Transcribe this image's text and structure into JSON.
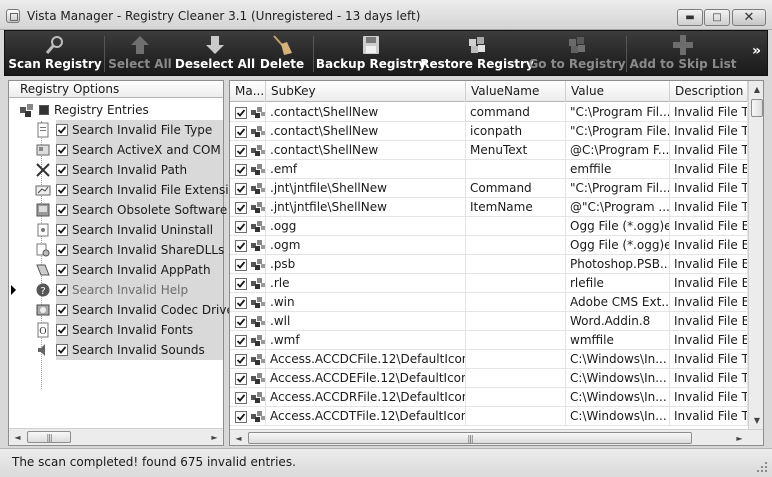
{
  "window": {
    "title": "Vista Manager - Registry Cleaner 3.1 (Unregistered - 13 days left)",
    "minimize_glyph": "▬",
    "maximize_glyph": "□",
    "close_glyph": "✕"
  },
  "toolbar": {
    "buttons": [
      {
        "label": "Scan Registry",
        "icon": "magnifier-icon",
        "enabled": true
      },
      {
        "label": "Select All",
        "icon": "arrow-up-icon",
        "enabled": false
      },
      {
        "label": "Deselect All",
        "icon": "arrow-down-icon",
        "enabled": true
      },
      {
        "label": "Delete",
        "icon": "broom-icon",
        "enabled": true
      },
      {
        "label": "Backup Registry",
        "icon": "floppy-disk-icon",
        "enabled": true
      },
      {
        "label": "Restore Registry",
        "icon": "restore-registry-icon",
        "enabled": true
      },
      {
        "label": "Go to Registry",
        "icon": "go-to-registry-icon",
        "enabled": false
      },
      {
        "label": "Add to Skip List",
        "icon": "plus-icon",
        "enabled": false
      }
    ],
    "more_glyph": "»"
  },
  "left_panel": {
    "header": "Registry Options",
    "root_label": "Registry Entries",
    "items": [
      {
        "label": "Search Invalid File Type",
        "icon": "file-type-icon",
        "checked": true
      },
      {
        "label": "Search ActiveX and COM",
        "icon": "activex-icon",
        "checked": true
      },
      {
        "label": "Search Invalid Path",
        "icon": "invalid-path-icon",
        "checked": true
      },
      {
        "label": "Search Invalid File Extension",
        "icon": "file-extension-icon",
        "checked": true
      },
      {
        "label": "Search Obsolete Software",
        "icon": "obsolete-software-icon",
        "checked": true
      },
      {
        "label": "Search Invalid Uninstall",
        "icon": "uninstall-icon",
        "checked": true
      },
      {
        "label": "Search Invalid ShareDLLs",
        "icon": "sharedlls-icon",
        "checked": true
      },
      {
        "label": "Search Invalid AppPath",
        "icon": "apppath-icon",
        "checked": true
      },
      {
        "label": "Search Invalid Help",
        "icon": "help-icon",
        "checked": true,
        "greyed": true,
        "current": true
      },
      {
        "label": "Search Invalid Codec Driver",
        "icon": "codec-driver-icon",
        "checked": true
      },
      {
        "label": "Search Invalid Fonts",
        "icon": "fonts-icon",
        "checked": true
      },
      {
        "label": "Search Invalid Sounds",
        "icon": "sounds-icon",
        "checked": true
      }
    ]
  },
  "grid": {
    "columns": [
      "Ma...",
      "SubKey",
      "ValueName",
      "Value",
      "Description"
    ],
    "rows": [
      {
        "subkey": ".contact\\ShellNew",
        "valuename": "command",
        "value": "\"C:\\Program Fil...",
        "description": "Invalid File Ty"
      },
      {
        "subkey": ".contact\\ShellNew",
        "valuename": "iconpath",
        "value": "\"C:\\Program File...",
        "description": "Invalid File Ty"
      },
      {
        "subkey": ".contact\\ShellNew",
        "valuename": "MenuText",
        "value": "@C:\\Program F...",
        "description": "Invalid File Ty"
      },
      {
        "subkey": ".emf",
        "valuename": "",
        "value": "emffile",
        "description": "Invalid File Ex"
      },
      {
        "subkey": ".jnt\\jntfile\\ShellNew",
        "valuename": "Command",
        "value": "\"C:\\Program Fil...",
        "description": "Invalid File Ty"
      },
      {
        "subkey": ".jnt\\jntfile\\ShellNew",
        "valuename": "ItemName",
        "value": "@\"C:\\Program ...",
        "description": "Invalid File Ty"
      },
      {
        "subkey": ".ogg",
        "valuename": "",
        "value": "Ogg File (*.ogg)e",
        "description": "Invalid File Ex"
      },
      {
        "subkey": ".ogm",
        "valuename": "",
        "value": "Ogg File (*.ogg)e",
        "description": "Invalid File Ex"
      },
      {
        "subkey": ".psb",
        "valuename": "",
        "value": "Photoshop.PSB....",
        "description": "Invalid File Ex"
      },
      {
        "subkey": ".rle",
        "valuename": "",
        "value": "rlefile",
        "description": "Invalid File Ex"
      },
      {
        "subkey": ".win",
        "valuename": "",
        "value": "Adobe CMS Ext...",
        "description": "Invalid File Ex"
      },
      {
        "subkey": ".wll",
        "valuename": "",
        "value": "Word.Addin.8",
        "description": "Invalid File Ex"
      },
      {
        "subkey": ".wmf",
        "valuename": "",
        "value": "wmffile",
        "description": "Invalid File Ex"
      },
      {
        "subkey": "Access.ACCDCFile.12\\DefaultIcon",
        "valuename": "",
        "value": "C:\\Windows\\In...",
        "description": "Invalid File Ty"
      },
      {
        "subkey": "Access.ACCDEFile.12\\DefaultIcon",
        "valuename": "",
        "value": "C:\\Windows\\In...",
        "description": "Invalid File Ty"
      },
      {
        "subkey": "Access.ACCDRFile.12\\DefaultIcon",
        "valuename": "",
        "value": "C:\\Windows\\In...",
        "description": "Invalid File Ty"
      },
      {
        "subkey": "Access.ACCDTFile.12\\DefaultIcon",
        "valuename": "",
        "value": "C:\\Windows\\In...",
        "description": "Invalid File Ty"
      }
    ]
  },
  "scroll": {
    "left_glyph": "◄",
    "right_glyph": "►",
    "up_glyph": "▲",
    "down_glyph": "▼",
    "grip_glyph": "|||"
  },
  "status": {
    "text": "The scan completed! found 675 invalid entries."
  },
  "colors": {
    "toolbar_bg": "#262626",
    "toolbar_text": "#ffffff",
    "toolbar_disabled_text": "#8a8a8a",
    "selected_row_bg": "#d9d9d9"
  }
}
